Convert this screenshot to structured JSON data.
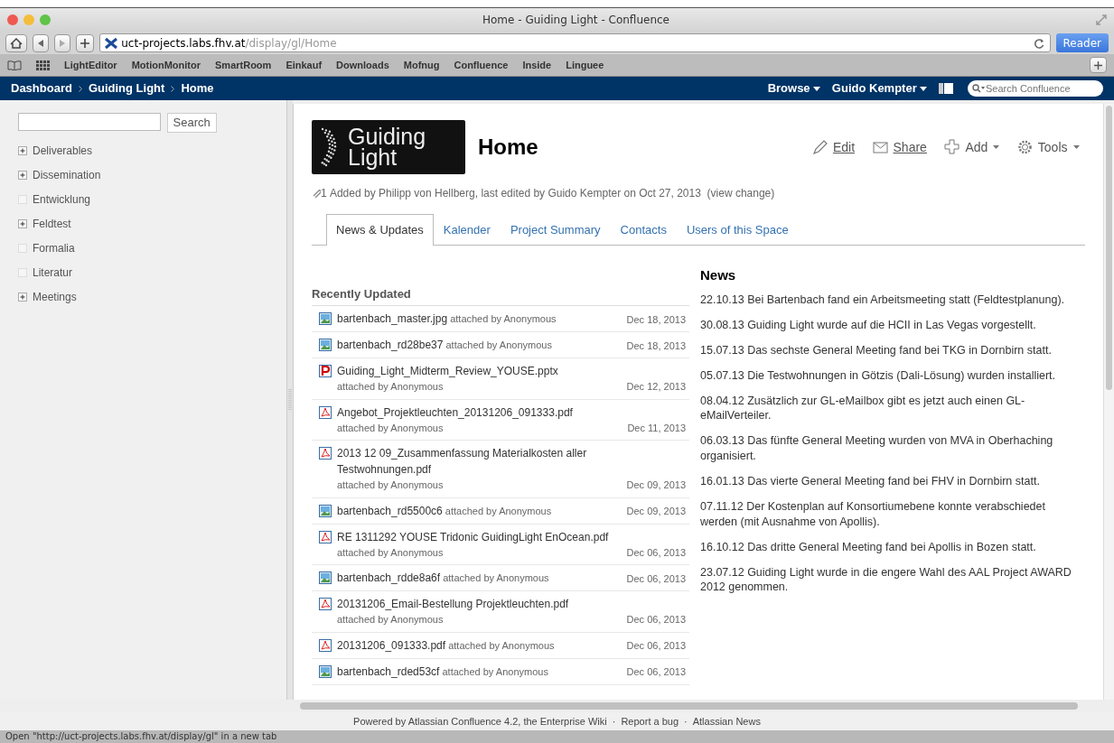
{
  "window": {
    "title": "Home - Guiding Light - Confluence"
  },
  "toolbar": {
    "url_host": "uct-projects.labs.fhv.at",
    "url_path": "/display/gl/Home",
    "reader": "Reader"
  },
  "bookmarks": [
    "LightEditor",
    "MotionMonitor",
    "SmartRoom",
    "Einkauf",
    "Downloads",
    "Mofnug",
    "Confluence",
    "Inside",
    "Linguee"
  ],
  "nav": {
    "breadcrumbs": [
      "Dashboard",
      "Guiding Light",
      "Home"
    ],
    "menus": [
      "Browse",
      "Guido Kempter"
    ],
    "search_placeholder": "Search Confluence"
  },
  "sidebar": {
    "search_button": "Search",
    "items": [
      {
        "label": "Deliverables",
        "expandable": true
      },
      {
        "label": "Dissemination",
        "expandable": true
      },
      {
        "label": "Entwicklung",
        "expandable": false
      },
      {
        "label": "Feldtest",
        "expandable": true
      },
      {
        "label": "Formalia",
        "expandable": false
      },
      {
        "label": "Literatur",
        "expandable": false
      },
      {
        "label": "Meetings",
        "expandable": true
      }
    ]
  },
  "page": {
    "logo_text": [
      "Guiding",
      "Light"
    ],
    "title": "Home",
    "actions": [
      {
        "label": "Edit",
        "kind": "edit",
        "dropdown": false
      },
      {
        "label": "Share",
        "kind": "share",
        "dropdown": false
      },
      {
        "label": "Add",
        "kind": "add",
        "dropdown": true
      },
      {
        "label": "Tools",
        "kind": "tools",
        "dropdown": true
      }
    ],
    "attachments": "1",
    "meta": [
      {
        "text": "Added by ",
        "link": false
      },
      {
        "text": "Philipp von Hellberg",
        "link": true
      },
      {
        "text": ", last edited by ",
        "link": false
      },
      {
        "text": "Guido Kempter",
        "link": true
      },
      {
        "text": " on Oct 27, 2013  (",
        "link": false
      },
      {
        "text": "view change",
        "link": true
      },
      {
        "text": ")",
        "link": false
      }
    ],
    "tabs": [
      {
        "label": "News & Updates",
        "selected": true
      },
      {
        "label": "Kalender",
        "selected": false
      },
      {
        "label": "Project Summary",
        "selected": false
      },
      {
        "label": "Contacts",
        "selected": false
      },
      {
        "label": "Users of this Space",
        "selected": false
      }
    ]
  },
  "recent": {
    "heading": "Recently Updated",
    "rows": [
      {
        "kind": "image",
        "name": "bartenbach_master.jpg",
        "meta": "attached by Anonymous",
        "date": "Dec 18, 2013"
      },
      {
        "kind": "image",
        "name": "bartenbach_rd28be37",
        "meta": "attached by Anonymous",
        "date": "Dec 18, 2013"
      },
      {
        "kind": "pptx",
        "name": "Guiding_Light_Midterm_Review_YOUSE.pptx",
        "meta": "attached by Anonymous",
        "date": "Dec 12, 2013"
      },
      {
        "kind": "pdf",
        "name": "Angebot_Projektleuchten_20131206_091333.pdf",
        "meta": "attached by Anonymous",
        "date": "Dec 11, 2013"
      },
      {
        "kind": "pdf",
        "name": "2013 12 09_Zusammenfassung Materialkosten aller Testwohnungen.pdf",
        "meta": "attached by Anonymous",
        "date": "Dec 09, 2013"
      },
      {
        "kind": "image",
        "name": "bartenbach_rd5500c6",
        "meta": "attached by Anonymous",
        "date": "Dec 09, 2013"
      },
      {
        "kind": "pdf",
        "name": "RE 1311292 YOUSE Tridonic GuidingLight EnOcean.pdf",
        "meta": "attached by Anonymous",
        "date": "Dec 06, 2013"
      },
      {
        "kind": "image",
        "name": "bartenbach_rdde8a6f",
        "meta": "attached by Anonymous",
        "date": "Dec 06, 2013"
      },
      {
        "kind": "pdf",
        "name": "20131206_Email-Bestellung Projektleuchten.pdf",
        "meta": "attached by Anonymous",
        "date": "Dec 06, 2013"
      },
      {
        "kind": "pdf",
        "name": "20131206_091333.pdf",
        "meta": "attached by Anonymous",
        "date": "Dec 06, 2013"
      },
      {
        "kind": "image",
        "name": "bartenbach_rded53cf",
        "meta": "attached by Anonymous",
        "date": "Dec 06, 2013"
      }
    ]
  },
  "news": {
    "heading": "News",
    "items": [
      "22.10.13 Bei Bartenbach fand ein Arbeitsmeeting statt (Feldtestplanung).",
      "30.08.13 Guiding Light wurde auf die HCII in Las Vegas vorgestellt.",
      "15.07.13 Das sechste General Meeting fand bei TKG in Dornbirn statt.",
      "05.07.13 Die Testwohnungen in Götzis (Dali-Lösung) wurden installiert.",
      "08.04.12 Zusätzlich zur GL-eMailbox gibt es jetzt auch einen GL-eMailVerteiler.",
      "06.03.13 Das fünfte General Meeting wurden von MVA in Oberhaching organisiert.",
      "16.01.13 Das vierte General Meeting fand bei FHV in Dornbirn statt.",
      "07.11.12 Der Kostenplan auf Konsortiumebene konnte verabschiedet werden (mit Ausnahme von Apollis).",
      "16.10.12 Das dritte General Meeting fand bei Apollis in Bozen statt.",
      "23.07.12 Guiding Light wurde in die engere Wahl des AAL Project AWARD 2012 genommen."
    ]
  },
  "footer": [
    "Powered by Atlassian Confluence 4.2, the Enterprise Wiki",
    "·",
    "Report a bug",
    "·",
    "Atlassian News"
  ],
  "status_bar": "Open \"http://uct-projects.labs.fhv.at/display/gl\" in a new tab"
}
